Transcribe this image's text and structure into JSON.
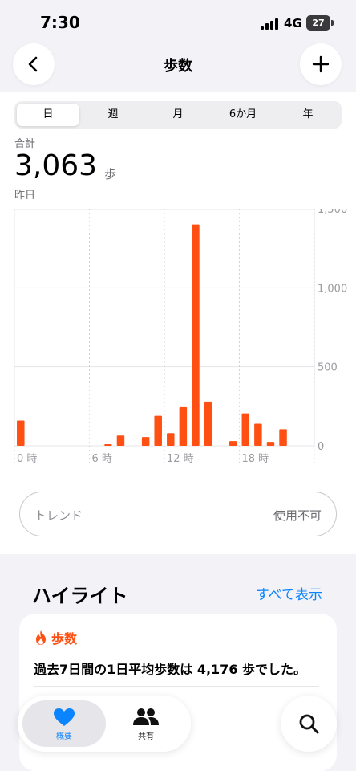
{
  "status": {
    "time": "7:30",
    "network": "4G",
    "battery": "27"
  },
  "nav": {
    "title": "歩数"
  },
  "range_tabs": [
    "日",
    "週",
    "月",
    "6か月",
    "年"
  ],
  "summary": {
    "label": "合計",
    "value": "3,063",
    "unit": "歩",
    "date": "昨日"
  },
  "trend": {
    "label": "トレンド",
    "status": "使用不可"
  },
  "highlights": {
    "title": "ハイライト",
    "show_all": "すべて表示",
    "card_category": "歩数",
    "card_text": "過去7日間の1日平均歩数は 4,176 歩でした。"
  },
  "tabs": {
    "summary": "概要",
    "sharing": "共有"
  },
  "colors": {
    "accent": "#ff4f13",
    "link": "#0a84ff"
  },
  "chart_data": {
    "type": "bar",
    "x": [
      "0時",
      "1時",
      "2時",
      "3時",
      "4時",
      "5時",
      "6時",
      "7時",
      "8時",
      "9時",
      "10時",
      "11時",
      "12時",
      "13時",
      "14時",
      "15時",
      "16時",
      "17時",
      "18時",
      "19時",
      "20時",
      "21時",
      "22時",
      "23時"
    ],
    "xticks": [
      "0 時",
      "6 時",
      "12 時",
      "18 時"
    ],
    "values": [
      160,
      0,
      0,
      0,
      0,
      0,
      0,
      10,
      65,
      0,
      55,
      190,
      80,
      245,
      1400,
      280,
      0,
      30,
      205,
      140,
      25,
      105,
      0,
      0
    ],
    "ylim": [
      0,
      1500
    ],
    "yticks": [
      "1,500",
      "1,000",
      "500",
      "0"
    ],
    "grid": true
  }
}
